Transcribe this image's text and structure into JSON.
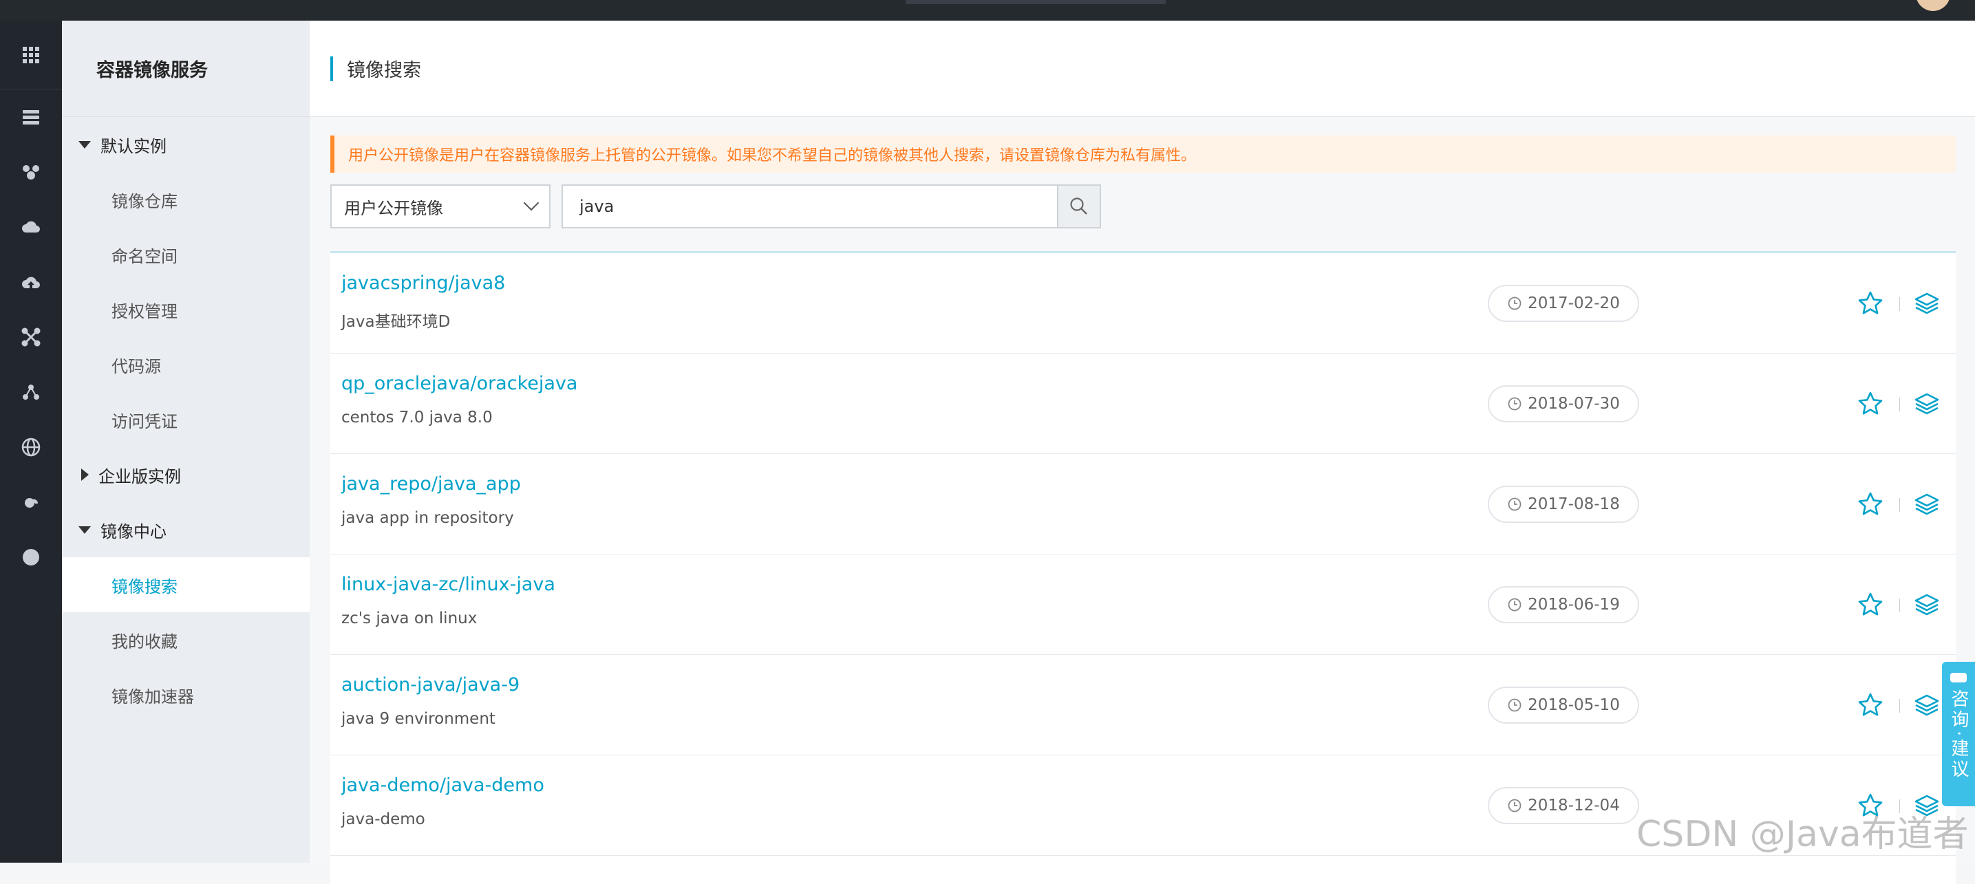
{
  "sidebar": {
    "title": "容器镜像服务",
    "groups": [
      {
        "label": "默认实例",
        "expanded": true,
        "items": [
          "镜像仓库",
          "命名空间",
          "授权管理",
          "代码源",
          "访问凭证"
        ]
      },
      {
        "label": "企业版实例",
        "expanded": false,
        "items": []
      },
      {
        "label": "镜像中心",
        "expanded": true,
        "items": [
          "镜像搜索",
          "我的收藏",
          "镜像加速器"
        ]
      }
    ],
    "active_item": "镜像搜索"
  },
  "header": {
    "title": "镜像搜索"
  },
  "notice": "用户公开镜像是用户在容器镜像服务上托管的公开镜像。如果您不希望自己的镜像被其他人搜索，请设置镜像仓库为私有属性。",
  "filter": {
    "source_select": "用户公开镜像",
    "search_value": "java"
  },
  "results": [
    {
      "name": "javacspring/java8",
      "desc": "Java基础环境D",
      "date": "2017-02-20"
    },
    {
      "name": "qp_oraclejava/orackejava",
      "desc": "centos 7.0 java 8.0",
      "date": "2018-07-30"
    },
    {
      "name": "java_repo/java_app",
      "desc": "java app in repository",
      "date": "2017-08-18"
    },
    {
      "name": "linux-java-zc/linux-java",
      "desc": "zc's java on linux",
      "date": "2018-06-19"
    },
    {
      "name": "auction-java/java-9",
      "desc": "java 9 environment",
      "date": "2018-05-10"
    },
    {
      "name": "java-demo/java-demo",
      "desc": "java-demo",
      "date": "2018-12-04"
    }
  ],
  "consult": {
    "label": "咨询·建议"
  },
  "watermark": "CSDN @Java布道者",
  "colors": {
    "accent": "#00a2ca",
    "notice_text": "#ff7a1f",
    "notice_bg": "#fff3e8",
    "rail_bg": "#22272d",
    "consult_bg": "#3cc0e8"
  },
  "icons": {
    "rail": [
      "grid-icon",
      "server-icon",
      "cluster-icon",
      "cloud-icon",
      "cloud-upload-icon",
      "network-icon",
      "nodes-icon",
      "globe-icon",
      "weather-icon",
      "circle-icon"
    ]
  }
}
